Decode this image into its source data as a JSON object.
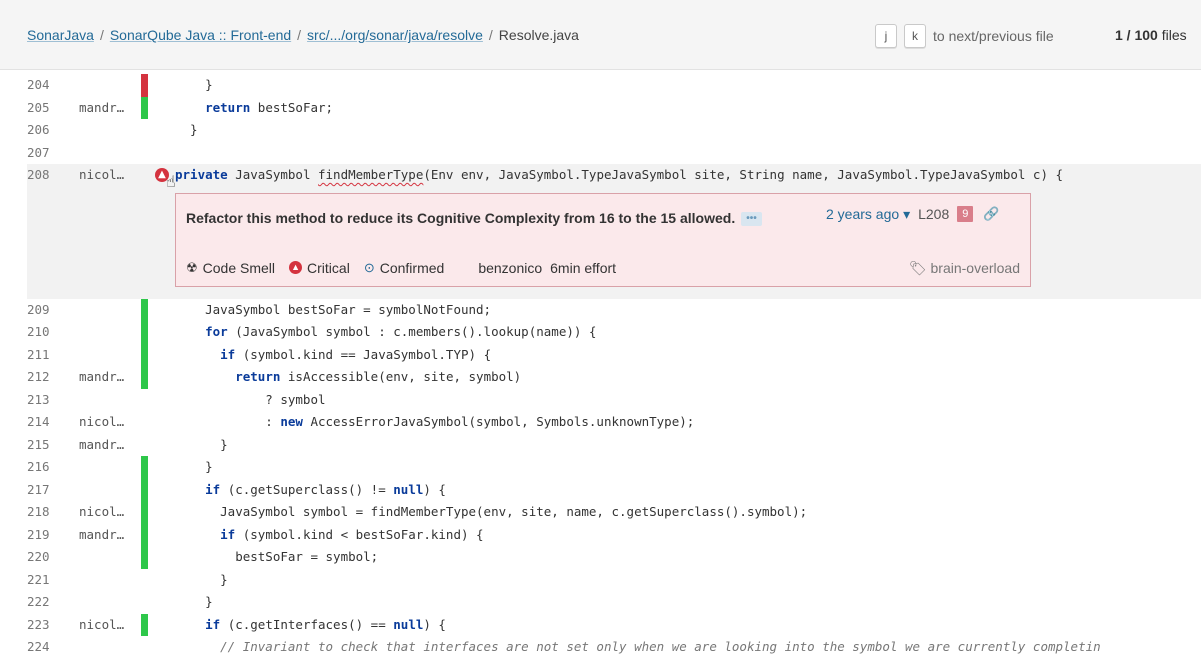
{
  "breadcrumb": {
    "items": [
      "SonarJava",
      "SonarQube Java :: Front-end",
      "src/.../org/sonar/java/resolve"
    ],
    "current": "Resolve.java"
  },
  "nav": {
    "key_next": "j",
    "key_prev": "k",
    "hint": "to next/previous file"
  },
  "counter": {
    "value": "1 / 100",
    "suffix": " files"
  },
  "issue": {
    "message": "Refactor this method to reduce its Cognitive Complexity from 16 to the 15 allowed.",
    "age": "2 years ago",
    "line_ref": "L208",
    "count_badge": "9",
    "type": "Code Smell",
    "severity": "Critical",
    "status": "Confirmed",
    "assignee": "benzonico",
    "effort": "6min effort",
    "tag": "brain-overload"
  },
  "lines_top": [
    {
      "n": "204",
      "author": "",
      "code": "    }"
    },
    {
      "n": "205",
      "author": "mandr…",
      "code": "    return bestSoFar;"
    },
    {
      "n": "206",
      "author": "",
      "code": "  }"
    },
    {
      "n": "207",
      "author": "",
      "code": ""
    },
    {
      "n": "208",
      "author": "nicol…",
      "code": "private JavaSymbol findMemberType(Env env, JavaSymbol.TypeJavaSymbol site, String name, JavaSymbol.TypeJavaSymbol c) {"
    }
  ],
  "lines_bottom": [
    {
      "n": "209",
      "author": "",
      "code": "    JavaSymbol bestSoFar = symbolNotFound;"
    },
    {
      "n": "210",
      "author": "",
      "code": "    for (JavaSymbol symbol : c.members().lookup(name)) {"
    },
    {
      "n": "211",
      "author": "",
      "code": "      if (symbol.kind == JavaSymbol.TYP) {"
    },
    {
      "n": "212",
      "author": "mandr…",
      "code": "        return isAccessible(env, site, symbol)"
    },
    {
      "n": "213",
      "author": "",
      "code": "            ? symbol"
    },
    {
      "n": "214",
      "author": "nicol…",
      "code": "            : new AccessErrorJavaSymbol(symbol, Symbols.unknownType);"
    },
    {
      "n": "215",
      "author": "mandr…",
      "code": "      }"
    },
    {
      "n": "216",
      "author": "",
      "code": "    }"
    },
    {
      "n": "217",
      "author": "",
      "code": "    if (c.getSuperclass() != null) {"
    },
    {
      "n": "218",
      "author": "nicol…",
      "code": "      JavaSymbol symbol = findMemberType(env, site, name, c.getSuperclass().symbol);"
    },
    {
      "n": "219",
      "author": "mandr…",
      "code": "      if (symbol.kind < bestSoFar.kind) {"
    },
    {
      "n": "220",
      "author": "",
      "code": "        bestSoFar = symbol;"
    },
    {
      "n": "221",
      "author": "",
      "code": "      }"
    },
    {
      "n": "222",
      "author": "",
      "code": "    }"
    },
    {
      "n": "223",
      "author": "nicol…",
      "code": "    if (c.getInterfaces() == null) {"
    },
    {
      "n": "224",
      "author": "",
      "code": "      // Invariant to check that interfaces are not set only when we are looking into the symbol we are currently completin"
    }
  ]
}
